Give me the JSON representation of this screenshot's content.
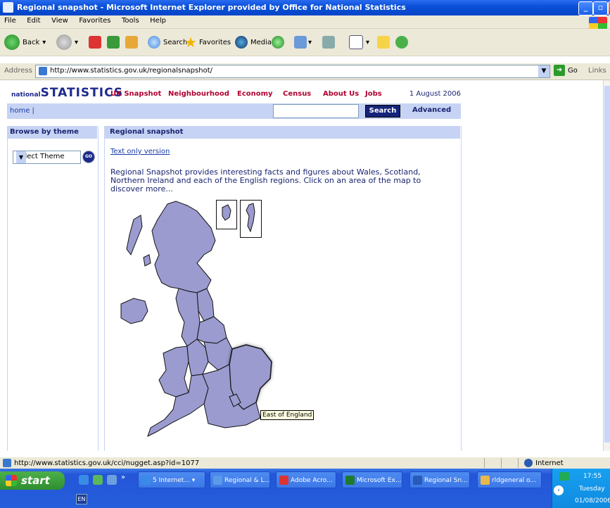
{
  "window": {
    "title": "Regional snapshot - Microsoft Internet Explorer provided by Office for National Statistics"
  },
  "menu": {
    "items": [
      "File",
      "Edit",
      "View",
      "Favorites",
      "Tools",
      "Help"
    ]
  },
  "toolbar": {
    "back": "Back",
    "search": "Search",
    "favorites": "Favorites",
    "media": "Media"
  },
  "address": {
    "label": "Address",
    "url": "http://www.statistics.gov.uk/regionalsnapshot/",
    "go": "Go",
    "links": "Links"
  },
  "site": {
    "logo_small": "national",
    "logo_big": "STATISTICS",
    "nav": [
      "UK Snapshot",
      "Neighbourhood",
      "Economy",
      "Census",
      "About Us",
      "Jobs"
    ],
    "date": "1 August 2006",
    "home": "home |",
    "search_button": "Search",
    "advanced": "Advanced"
  },
  "sidebar": {
    "heading": "Browse by theme",
    "select_value": "Select Theme",
    "go": "GO"
  },
  "main": {
    "heading": "Regional snapshot",
    "text_only": "Text only version",
    "intro": "Regional Snapshot provides interesting facts and figures about Wales, Scotland, Northern Ireland and each of the English regions. Click on an area of the map to discover more...",
    "tooltip": "East of England"
  },
  "status": {
    "url": "http://www.statistics.gov.uk/cci/nugget.asp?id=1077",
    "zone": "Internet"
  },
  "taskbar": {
    "start": "start",
    "tasks": [
      "5 Internet...",
      "Regional & L...",
      "Adobe Acro...",
      "Microsoft Ex...",
      "Regional Sn...",
      "rldgeneral o..."
    ],
    "lang": "EN",
    "time": "17:55",
    "day": "Tuesday",
    "date": "01/08/2006"
  },
  "colors": {
    "map_fill": "#9b9bd0",
    "nav_red": "#b00030",
    "header_blue": "#c6d3f4",
    "navy": "#1a2470"
  }
}
